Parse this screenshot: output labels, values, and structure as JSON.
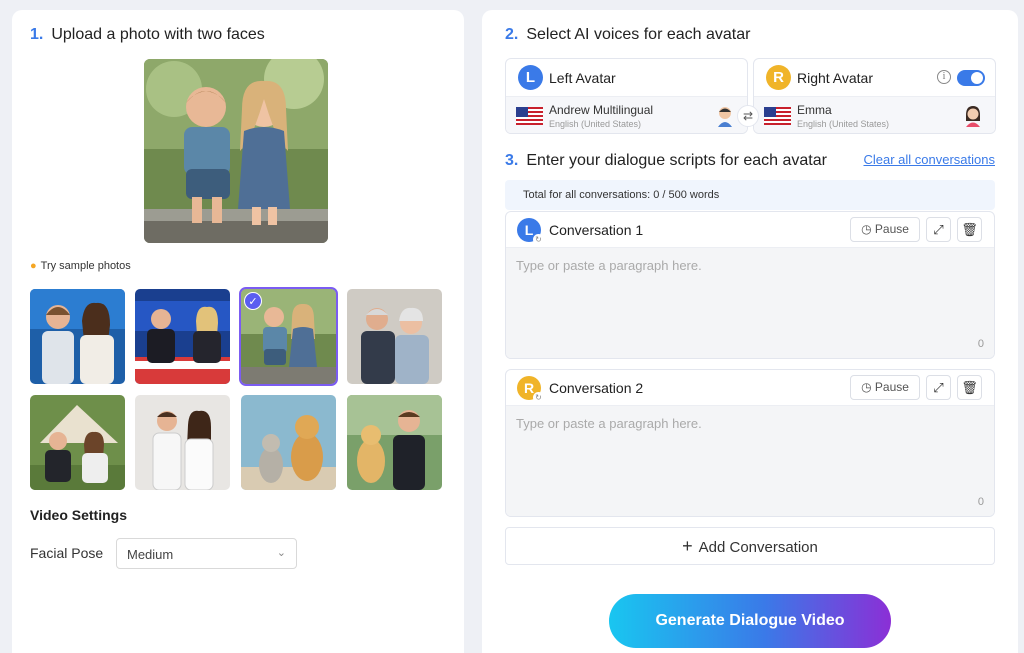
{
  "step1": {
    "num": "1.",
    "title": "Upload a photo with two faces"
  },
  "samples": {
    "label": "Try sample photos",
    "selected_index": 2
  },
  "video_settings": {
    "title": "Video Settings",
    "facial_pose_label": "Facial Pose",
    "facial_pose_value": "Medium"
  },
  "step2": {
    "num": "2.",
    "title": "Select AI voices for each avatar"
  },
  "left_avatar": {
    "badge": "L",
    "name": "Left Avatar",
    "voice_name": "Andrew Multilingual",
    "voice_locale": "English (United States)"
  },
  "right_avatar": {
    "badge": "R",
    "name": "Right Avatar",
    "voice_name": "Emma",
    "voice_locale": "English (United States)",
    "toggle_on": true
  },
  "step3": {
    "num": "3.",
    "title": "Enter your dialogue scripts for each avatar"
  },
  "clear_all": "Clear all conversations",
  "total": "Total for all conversations: 0 / 500 words",
  "conversations": [
    {
      "badge": "L",
      "title": "Conversation 1",
      "pause": "Pause",
      "placeholder": "Type or paste a paragraph here.",
      "count": "0"
    },
    {
      "badge": "R",
      "title": "Conversation 2",
      "pause": "Pause",
      "placeholder": "Type or paste a paragraph here.",
      "count": "0"
    }
  ],
  "add_conversation": "Add Conversation",
  "generate": "Generate Dialogue Video",
  "colors": {
    "accent": "#3a7ae8",
    "right_badge": "#f0b429",
    "selected_outline": "#7b5cf2"
  },
  "icons": [
    "bulb-icon",
    "check-icon",
    "chevron-down-icon",
    "swap-icon",
    "info-icon",
    "clock-icon",
    "expand-icon",
    "trash-icon",
    "plus-icon",
    "refresh-icon"
  ]
}
